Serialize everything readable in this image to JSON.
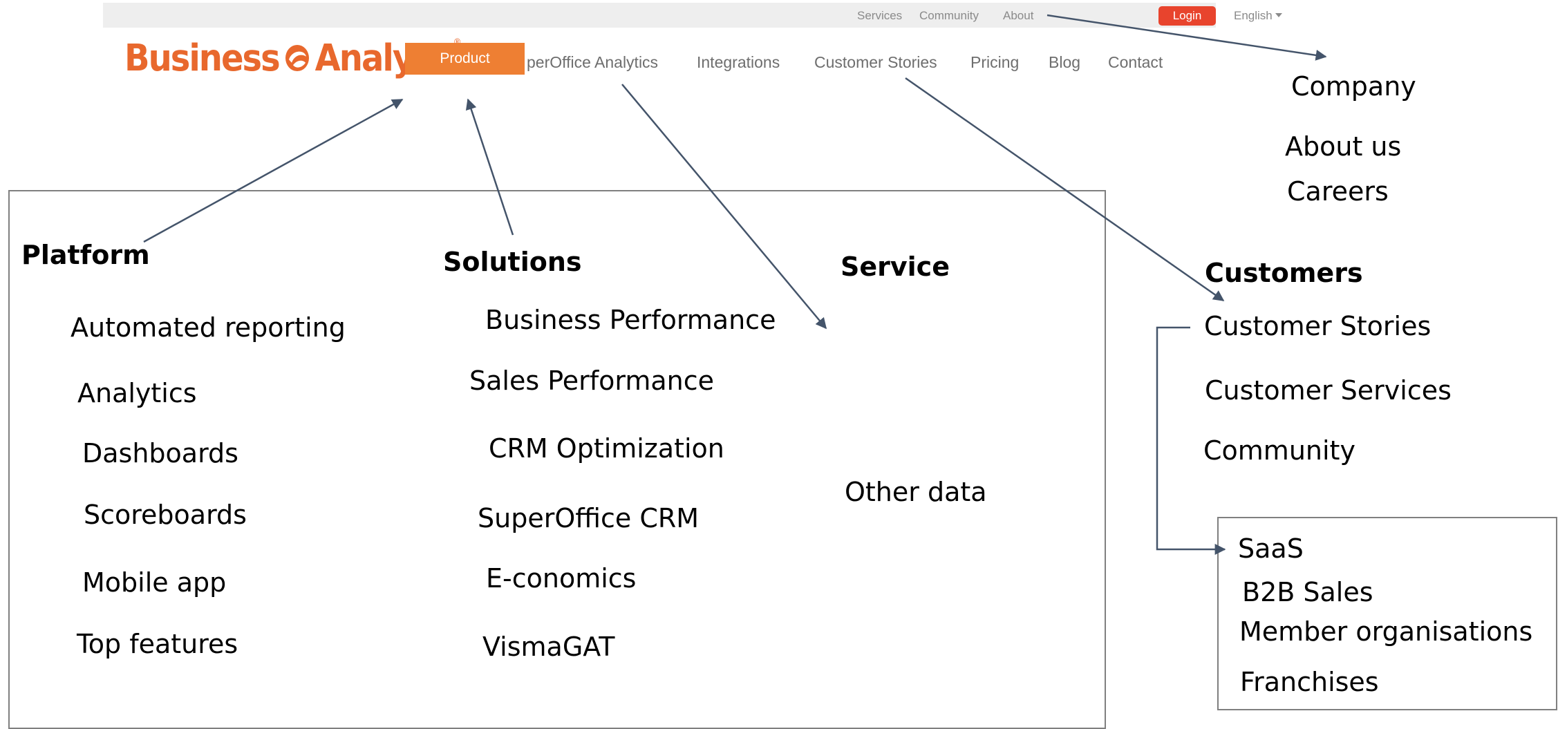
{
  "utility_bar": {
    "links": [
      "Services",
      "Community",
      "About"
    ],
    "login_label": "Login",
    "language": "English"
  },
  "logo": {
    "word1": "Business",
    "word2": "Analyze",
    "registered": "®"
  },
  "nav": {
    "product_label": "Product",
    "items": [
      "perOffice Analytics",
      "Integrations",
      "Customer Stories",
      "Pricing",
      "Blog",
      "Contact"
    ]
  },
  "company": {
    "title": "Company",
    "items": [
      "About us",
      "Careers"
    ]
  },
  "platform": {
    "title": "Platform",
    "items": [
      "Automated reporting",
      "Analytics",
      "Dashboards",
      "Scoreboards",
      "Mobile app",
      "Top features"
    ]
  },
  "solutions": {
    "title": "Solutions",
    "items": [
      "Business Performance",
      "Sales Performance",
      "CRM Optimization",
      "SuperOffice CRM",
      "E-conomics",
      "VismaGAT"
    ]
  },
  "service": {
    "title": "Service",
    "items": [
      "Other data"
    ]
  },
  "customers": {
    "title": "Customers",
    "items": [
      "Customer Stories",
      "Customer Services",
      "Community"
    ]
  },
  "segments": {
    "items": [
      "SaaS",
      "B2B Sales",
      "Member organisations",
      "Franchises"
    ]
  },
  "colors": {
    "brand_orange": "#ee7f33",
    "logo_orange": "#e8682d",
    "login_red": "#e8442d",
    "arrow": "#44546a",
    "box_border": "#7f7f7f"
  }
}
